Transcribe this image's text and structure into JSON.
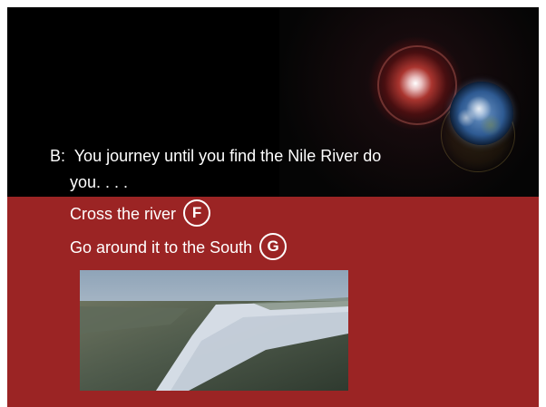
{
  "slide": {
    "question_label": "B:",
    "question_line1": "You journey until you find the Nile River do",
    "question_line2": "you. . . .",
    "options": [
      {
        "text": "Cross the river",
        "badge": "F"
      },
      {
        "text": "Go around it to the South",
        "badge": "G"
      }
    ]
  },
  "colors": {
    "background_top": "#000000",
    "background_bottom": "#9b2424",
    "text": "#ffffff"
  },
  "images": {
    "top_right": "earth-in-space-photo",
    "bottom": "nile-river-aerial-photo"
  }
}
